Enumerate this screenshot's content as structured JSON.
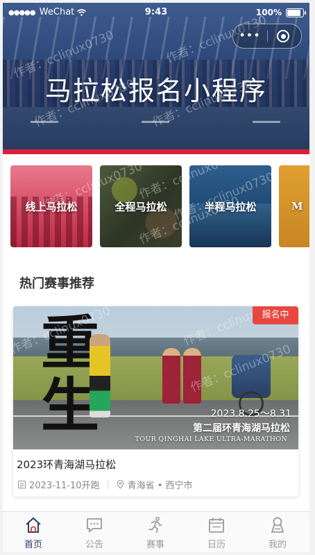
{
  "status_bar": {
    "signal_dots": "●●●●●",
    "carrier": "WeChat",
    "time": "9:43",
    "battery_text": "100%",
    "battery_level": 1.0
  },
  "capsule": {
    "more_glyph": "•••"
  },
  "banner": {
    "title": "马拉松报名小程序"
  },
  "categories": [
    {
      "label": "线上马拉松"
    },
    {
      "label": "全程马拉松"
    },
    {
      "label": "半程马拉松"
    },
    {
      "label": "M"
    }
  ],
  "section": {
    "title": "热门赛事推荐"
  },
  "race": {
    "badge": "报名中",
    "image_calligraphy": "重\n生",
    "image_date": "2023.8.25～8.31",
    "image_title_cn": "第二届环青海湖马拉松",
    "image_title_en": "TOUR QINGHAI LAKE ULTRA-MARATHON",
    "name": "2023环青海湖马拉松",
    "date": "2023-11-10开跑",
    "location": "青海省 • 西宁市"
  },
  "watermark": "作者：cclinux0730",
  "tabbar": {
    "tabs": [
      {
        "label": "首页",
        "icon": "home-icon",
        "active": true
      },
      {
        "label": "公告",
        "icon": "message-icon",
        "active": false
      },
      {
        "label": "赛事",
        "icon": "runner-icon",
        "active": false
      },
      {
        "label": "日历",
        "icon": "calendar-icon",
        "active": false
      },
      {
        "label": "我的",
        "icon": "user-icon",
        "active": false
      }
    ]
  },
  "colors": {
    "accent_red": "#d9213b",
    "badge_red": "#e8473f",
    "tab_active": "#2a3d66",
    "tab_inactive": "#9a9a9a"
  }
}
